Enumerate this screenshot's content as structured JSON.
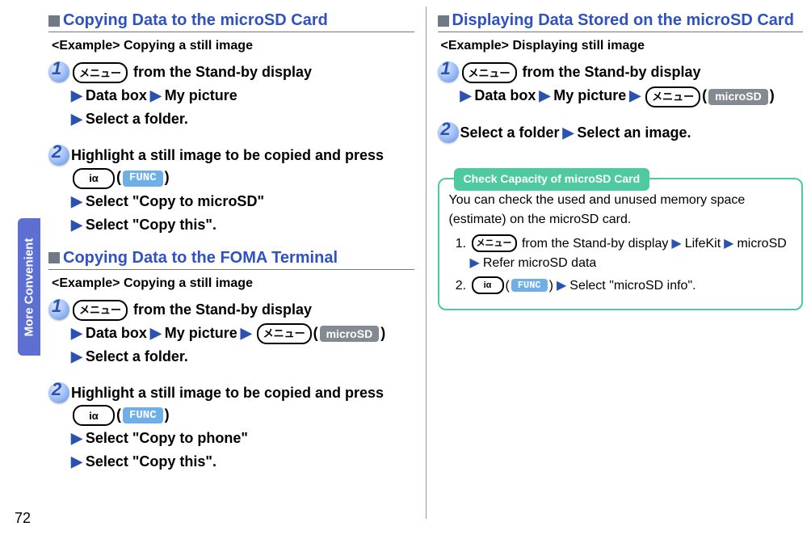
{
  "sidebar": {
    "tab_label": "More Convenient"
  },
  "page_number": "72",
  "icons": {
    "menu": "メニュー",
    "i_alpha": "iα"
  },
  "pills": {
    "func": "FUNC",
    "microsd": "microSD"
  },
  "left_col": {
    "section1": {
      "title": "Copying Data to the microSD Card",
      "example": "<Example> Copying a still image",
      "step1": {
        "from": " from the Stand-by display",
        "l2a": "Data box",
        "l2b": "My picture",
        "l3": "Select a folder."
      },
      "step2": {
        "l1": "Highlight a still image to be copied and press ",
        "l2pre": "Select ",
        "l2q": "\"Copy to microSD\"",
        "l3pre": "Select ",
        "l3q": "\"Copy this\"."
      }
    },
    "section2": {
      "title": "Copying Data to the FOMA Terminal",
      "example": "<Example> Copying a still image",
      "step1": {
        "from": " from the Stand-by display",
        "l2a": "Data box",
        "l2b": "My picture",
        "l3": "Select a folder."
      },
      "step2": {
        "l1": "Highlight a still image to be copied and press ",
        "l2pre": "Select ",
        "l2q": "\"Copy to phone\"",
        "l3pre": "Select ",
        "l3q": "\"Copy this\"."
      }
    }
  },
  "right_col": {
    "section": {
      "title": "Displaying Data Stored on the microSD Card",
      "example": "<Example> Displaying still image",
      "step1": {
        "from": " from the Stand-by display",
        "l2a": "Data box",
        "l2b": "My picture"
      },
      "step2": {
        "l1a": "Select a folder",
        "l1b": "Select an image."
      }
    },
    "notebox": {
      "title": "Check Capacity of microSD Card",
      "intro": "You can check the used and unused memory space (estimate) on the microSD card.",
      "li1": {
        "a": "from the Stand-by display",
        "b": "LifeKit",
        "c": "microSD",
        "d": "Refer microSD data"
      },
      "li2": {
        "a": "Select \"microSD info\"."
      }
    }
  }
}
